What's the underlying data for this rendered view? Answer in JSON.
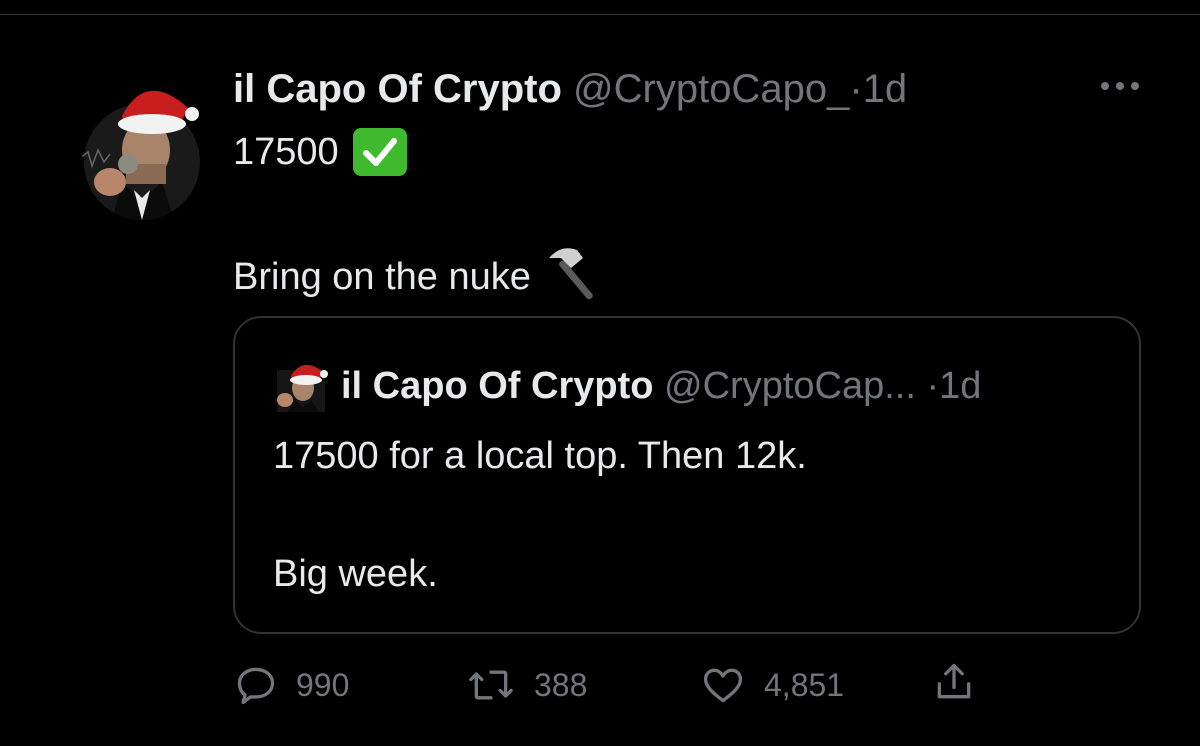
{
  "tweet": {
    "author_name": "il Capo Of Crypto",
    "handle": "@CryptoCapo_",
    "separator": "·",
    "time": "1d",
    "more_icon": "more-horizontal-icon",
    "line1": "17500",
    "line1_emoji": "check-mark-button-icon",
    "line2": "Bring on the nuke",
    "line2_emoji": "hammer-icon"
  },
  "quoted": {
    "author_name": "il Capo Of Crypto",
    "handle": "@CryptoCap...",
    "separator": "·",
    "time": "1d",
    "text_line1": "17500 for a local top. Then 12k.",
    "text_line2": "Big week."
  },
  "actions": {
    "replies": "990",
    "retweets": "388",
    "likes": "4,851"
  },
  "colors": {
    "background": "#000000",
    "primary_text": "#e7e9ea",
    "secondary_text": "#71767b",
    "border": "#2f3336",
    "check_green": "#3fba2e"
  }
}
